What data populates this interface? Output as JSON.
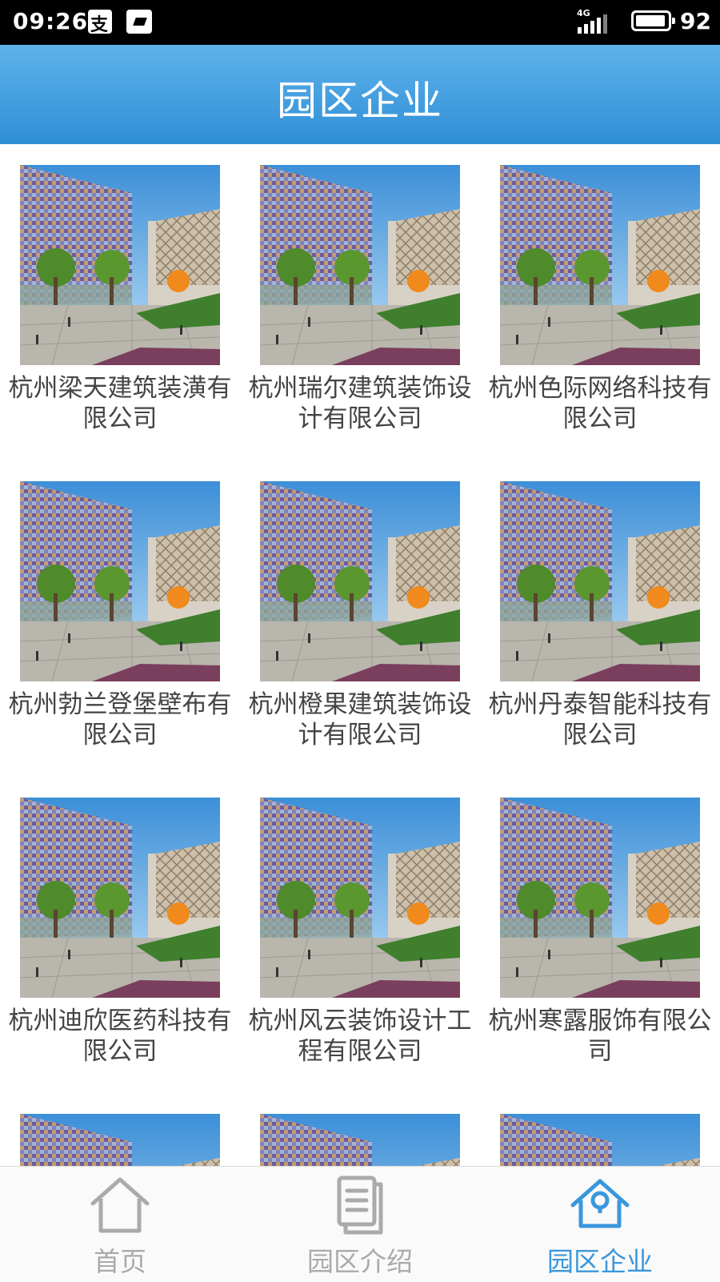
{
  "status_bar": {
    "time": "09:26",
    "network_type": "4G",
    "battery_level": "92",
    "icons": [
      "alipay-icon",
      "screenshot-icon",
      "signal-icon",
      "battery-icon"
    ]
  },
  "header": {
    "title": "园区企业"
  },
  "companies": [
    "杭州梁天建筑装潢有限公司",
    "杭州瑞尔建筑装饰设计有限公司",
    "杭州色际网络科技有限公司",
    "杭州勃兰登堡壁布有限公司",
    "杭州橙果建筑装饰设计有限公司",
    "杭州丹泰智能科技有限公司",
    "杭州迪欣医药科技有限公司",
    "杭州风云装饰设计工程有限公司",
    "杭州寒露服饰有限公司"
  ],
  "nav": {
    "items": [
      {
        "label": "首页",
        "icon": "home-icon",
        "active": false
      },
      {
        "label": "园区介绍",
        "icon": "document-icon",
        "active": false
      },
      {
        "label": "园区企业",
        "icon": "enterprise-icon",
        "active": true
      }
    ]
  },
  "colors": {
    "accent": "#3a97dd",
    "header_top": "#5fb2eb",
    "header_bottom": "#2f8fd6",
    "inactive": "#aaaaaa"
  }
}
